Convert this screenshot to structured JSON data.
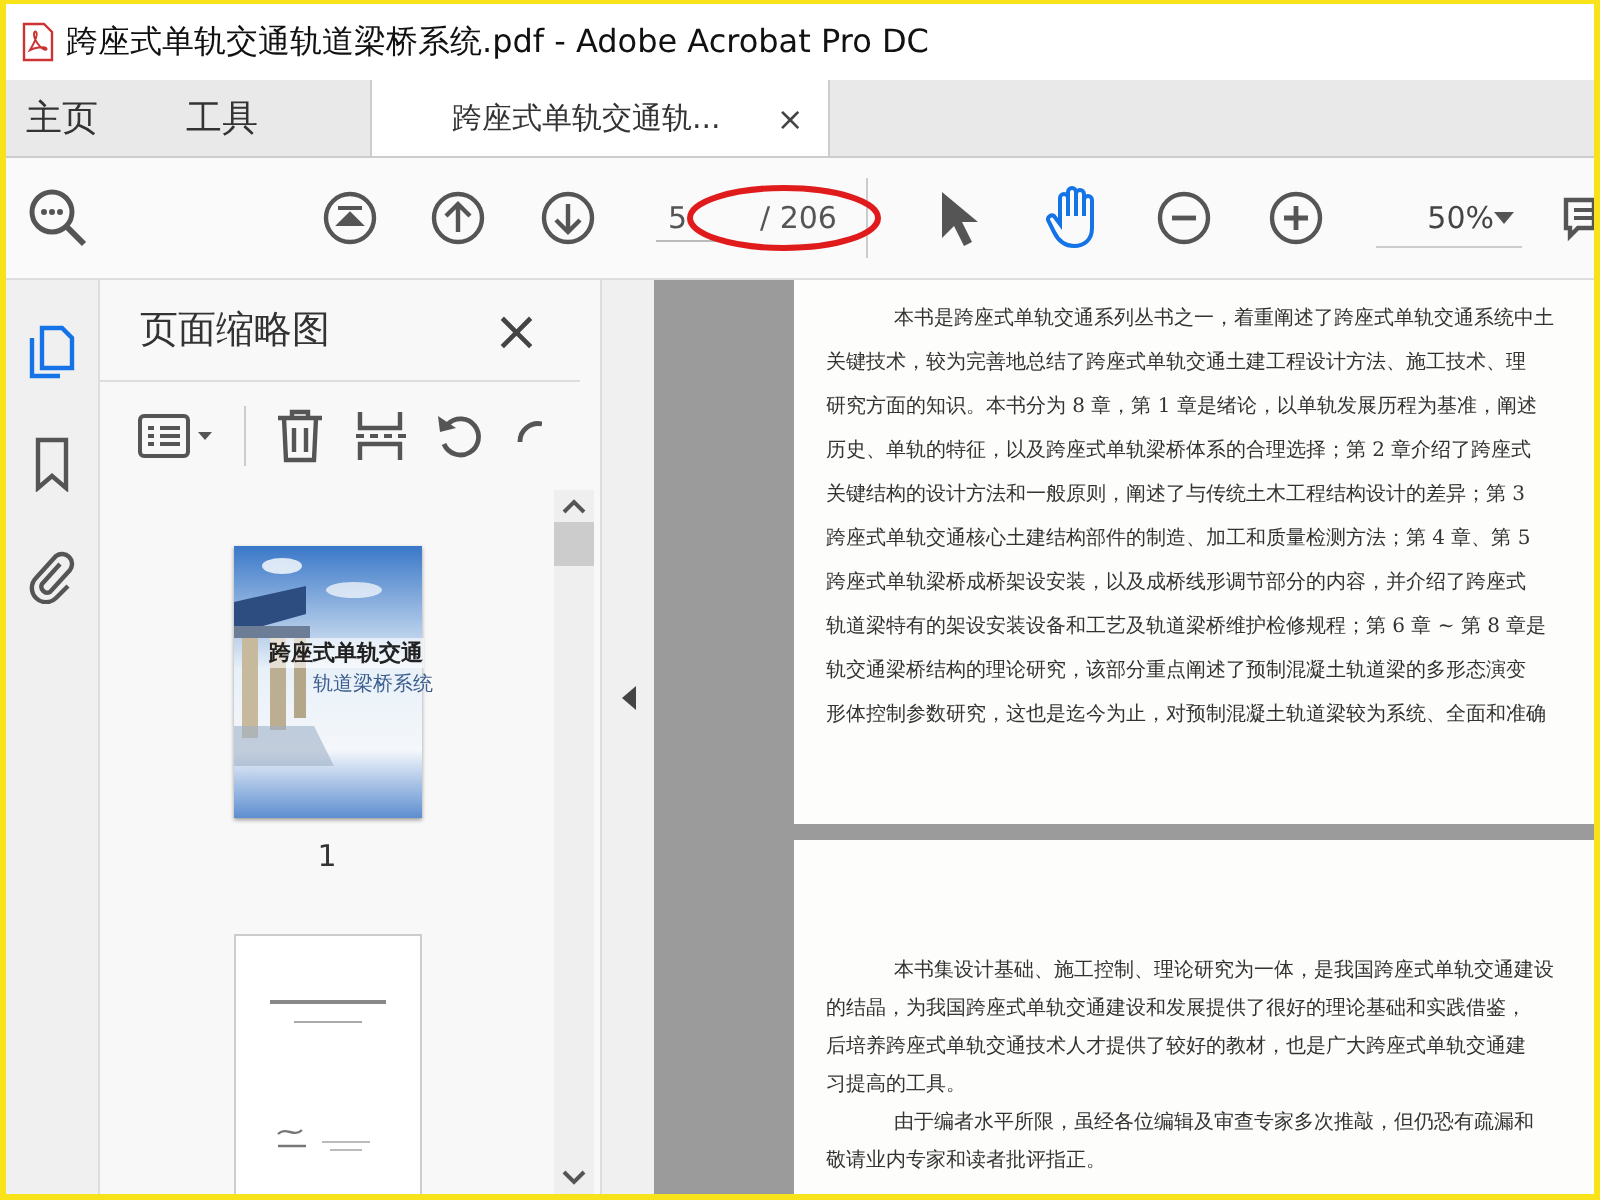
{
  "window": {
    "title": "跨座式单轨交通轨道梁桥系统.pdf - Adobe Acrobat Pro DC"
  },
  "tabs": [
    {
      "label": "主页",
      "selected": false
    },
    {
      "label": "工具",
      "selected": false
    },
    {
      "label": "跨座式单轨交通轨...",
      "selected": true,
      "close": "×"
    }
  ],
  "toolbar": {
    "page_field": {
      "value": "5"
    },
    "page_total": "/ 206",
    "page_count_circled": true,
    "tools": [
      {
        "kind": "select",
        "selected": false
      },
      {
        "kind": "hand",
        "selected": true
      }
    ],
    "zoom": "50%"
  },
  "side_rail": [
    {
      "kind": "pages",
      "selected": true
    },
    {
      "kind": "bookmark",
      "selected": false
    },
    {
      "kind": "attachment",
      "selected": false
    }
  ],
  "thumbnail_panel": {
    "title": "页面缩略图",
    "close": "×",
    "thumbnails": [
      {
        "kind": "cover",
        "label": "1",
        "cover_title": "跨座式单轨交通",
        "cover_subtitle": "轨道梁桥系统"
      },
      {
        "kind": "title_page"
      }
    ]
  },
  "pages": [
    {
      "paragraphs": [
        [
          "本书是跨座式单轨交通系列丛书之一，着重阐述了跨座式单轨交通系统中土",
          "关键技术，较为完善地总结了跨座式单轨交通土建工程设计方法、施工技术、理",
          "研究方面的知识。本书分为 8 章，第 1 章是绪论，以单轨发展历程为基准，阐述",
          "历史、单轨的特征，以及跨座式单轨梁桥体系的合理选择；第 2 章介绍了跨座式",
          "关键结构的设计方法和一般原则，阐述了与传统土木工程结构设计的差异；第 3",
          "跨座式单轨交通核心土建结构部件的制造、加工和质量检测方法；第 4 章、第 5",
          "跨座式单轨梁桥成桥架设安装，以及成桥线形调节部分的内容，并介绍了跨座式",
          "轨道梁特有的架设安装设备和工艺及轨道梁桥维护检修规程；第 6 章 ~ 第 8 章是",
          "轨交通梁桥结构的理论研究，该部分重点阐述了预制混凝土轨道梁的多形态演变",
          "形体控制参数研究，这也是迄今为止，对预制混凝土轨道梁较为系统、全面和准确"
        ]
      ]
    },
    {
      "paragraphs": [
        [
          "本书集设计基础、施工控制、理论研究为一体，是我国跨座式单轨交通建设",
          "的结晶，为我国跨座式单轨交通建设和发展提供了很好的理论基础和实践借鉴，",
          "后培养跨座式单轨交通技术人才提供了较好的教材，也是广大跨座式单轨交通建",
          "习提高的工具。"
        ],
        [
          "由于编者水平所限，虽经各位编辑及审查专家多次推敲，但仍恐有疏漏和",
          "敬请业内专家和读者批评指正。"
        ]
      ]
    }
  ]
}
